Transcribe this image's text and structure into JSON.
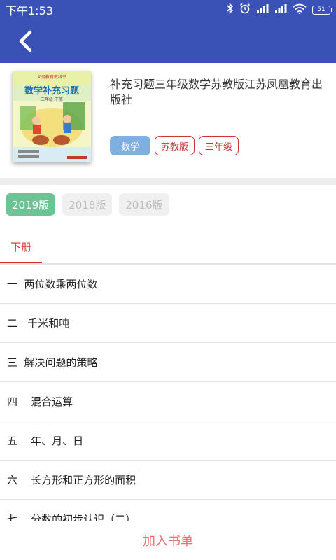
{
  "status": {
    "time": "下午1:53",
    "battery": "51",
    "icons": [
      "bluetooth-icon",
      "alarm-icon",
      "signal-icon",
      "signal-icon",
      "wifi-icon",
      "battery-icon"
    ]
  },
  "appbar": {
    "back_icon": "chevron-left-icon"
  },
  "book": {
    "title": "补充习题三年级数学苏教版江苏凤凰教育出版社",
    "cover": {
      "header_text": "义务教育教科书",
      "title": "数学补充习题",
      "subtitle": "三年级 下册"
    },
    "tags": [
      {
        "label": "数学",
        "style": "primary"
      },
      {
        "label": "苏教版",
        "style": "outline"
      },
      {
        "label": "三年级",
        "style": "outline"
      }
    ]
  },
  "editions": [
    {
      "label": "2019版",
      "active": true
    },
    {
      "label": "2018版",
      "active": false
    },
    {
      "label": "2016版",
      "active": false
    }
  ],
  "volume_tabs": [
    {
      "label": "下册",
      "active": true
    }
  ],
  "chapters": [
    {
      "label": "一  两位数乘两位数"
    },
    {
      "label": "二   千米和吨"
    },
    {
      "label": "三  解决问题的策略"
    },
    {
      "label": "四    混合运算"
    },
    {
      "label": "五    年、月、日"
    },
    {
      "label": "六    长方形和正方形的面积"
    },
    {
      "label": "七    分数的初步认识（二）"
    }
  ],
  "bottom": {
    "add_label": "加入书单"
  },
  "colors": {
    "primary": "#3a51b5",
    "accent_red": "#d32f2f",
    "edition_active": "#6bc493",
    "tag_blue": "#7faee0"
  }
}
